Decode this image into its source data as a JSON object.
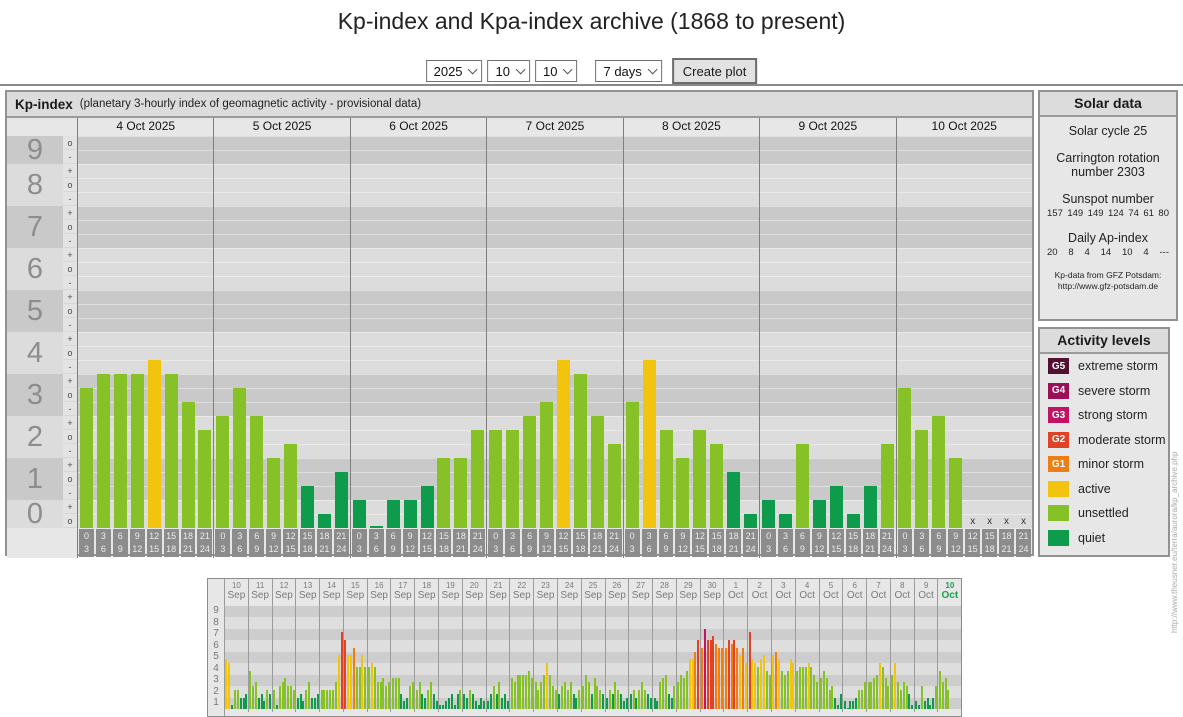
{
  "page": {
    "title": "Kp-index and Kpa-index archive (1868 to present)"
  },
  "controls": {
    "year": "2025",
    "month": "10",
    "day": "10",
    "range": "7 days",
    "create_button": "Create plot"
  },
  "colors": {
    "quiet": "#0f9b4c",
    "unsettled": "#85c127",
    "active": "#f2c40e",
    "g1": "#ef7d12",
    "g2": "#e04226",
    "g3": "#c31163",
    "g4": "#9c0e56",
    "g5": "#531031",
    "band_dark": "#c9c9c9",
    "band_light": "#dcdcdc",
    "mini_band_dark": "#cdcdcd",
    "mini_band_light": "#dedede"
  },
  "chart_data": {
    "type": "bar",
    "title": "Kp-index",
    "subtitle": "(planetary 3-hourly index of geomagnetic activity - provisional data)",
    "ylabel": "Kp",
    "ylim": [
      0,
      9
    ],
    "y_labels": [
      "9",
      "8",
      "7",
      "6",
      "5",
      "4",
      "3",
      "2",
      "1",
      "0"
    ],
    "sub_symbols": [
      "+",
      "o",
      "-"
    ],
    "intervals": [
      [
        "0",
        "3"
      ],
      [
        "3",
        "6"
      ],
      [
        "6",
        "9"
      ],
      [
        "9",
        "12"
      ],
      [
        "12",
        "15"
      ],
      [
        "15",
        "18"
      ],
      [
        "18",
        "21"
      ],
      [
        "21",
        "24"
      ]
    ],
    "no_data_marker": "x",
    "days": [
      {
        "label": "4 Oct 2025",
        "kp_thirds": [
          10,
          11,
          11,
          11,
          12,
          11,
          9,
          7
        ]
      },
      {
        "label": "5 Oct 2025",
        "kp_thirds": [
          8,
          10,
          8,
          5,
          6,
          3,
          1,
          4
        ]
      },
      {
        "label": "6 Oct 2025",
        "kp_thirds": [
          2,
          0,
          2,
          2,
          3,
          5,
          5,
          7
        ]
      },
      {
        "label": "7 Oct 2025",
        "kp_thirds": [
          7,
          7,
          8,
          9,
          12,
          11,
          8,
          6
        ]
      },
      {
        "label": "8 Oct 2025",
        "kp_thirds": [
          9,
          12,
          7,
          5,
          7,
          6,
          4,
          1
        ]
      },
      {
        "label": "9 Oct 2025",
        "kp_thirds": [
          2,
          1,
          6,
          2,
          3,
          1,
          3,
          6
        ]
      },
      {
        "label": "10 Oct 2025",
        "kp_thirds": [
          10,
          7,
          8,
          5,
          null,
          null,
          null,
          null
        ]
      }
    ]
  },
  "mini_chart": {
    "type": "bar",
    "y_labels": [
      "9",
      "8",
      "7",
      "6",
      "5",
      "4",
      "3",
      "2",
      "1"
    ],
    "days": [
      {
        "num": "10",
        "mon": "Sep",
        "t": [
          13,
          12,
          1,
          5,
          5,
          3,
          3,
          4
        ]
      },
      {
        "num": "11",
        "mon": "Sep",
        "t": [
          10,
          6,
          7,
          3,
          4,
          2,
          5,
          4
        ]
      },
      {
        "num": "12",
        "mon": "Sep",
        "t": [
          5,
          1,
          6,
          7,
          8,
          6,
          6,
          5
        ]
      },
      {
        "num": "13",
        "mon": "Sep",
        "t": [
          3,
          4,
          2,
          5,
          7,
          3,
          3,
          4
        ]
      },
      {
        "num": "14",
        "mon": "Sep",
        "t": [
          5,
          5,
          5,
          5,
          5,
          7,
          14,
          20
        ]
      },
      {
        "num": "15",
        "mon": "Sep",
        "t": [
          18,
          14,
          14,
          16,
          11,
          11,
          14,
          11
        ]
      },
      {
        "num": "16",
        "mon": "Sep",
        "t": [
          11,
          12,
          11,
          7,
          7,
          8,
          6,
          7
        ]
      },
      {
        "num": "17",
        "mon": "Sep",
        "t": [
          8,
          8,
          8,
          4,
          2,
          3,
          6,
          7
        ]
      },
      {
        "num": "18",
        "mon": "Sep",
        "t": [
          5,
          7,
          4,
          3,
          5,
          7,
          4,
          2
        ]
      },
      {
        "num": "19",
        "mon": "Sep",
        "t": [
          1,
          1,
          2,
          3,
          4,
          1,
          4,
          5
        ]
      },
      {
        "num": "20",
        "mon": "Sep",
        "t": [
          4,
          3,
          5,
          4,
          2,
          1,
          3,
          2
        ]
      },
      {
        "num": "21",
        "mon": "Sep",
        "t": [
          2,
          4,
          6,
          4,
          7,
          3,
          4,
          2
        ]
      },
      {
        "num": "22",
        "mon": "Sep",
        "t": [
          8,
          7,
          9,
          9,
          9,
          9,
          10,
          8
        ]
      },
      {
        "num": "23",
        "mon": "Sep",
        "t": [
          7,
          5,
          7,
          9,
          12,
          9,
          6,
          5
        ]
      },
      {
        "num": "24",
        "mon": "Sep",
        "t": [
          4,
          6,
          7,
          5,
          7,
          4,
          3,
          5
        ]
      },
      {
        "num": "25",
        "mon": "Sep",
        "t": [
          6,
          9,
          7,
          4,
          8,
          6,
          5,
          4
        ]
      },
      {
        "num": "26",
        "mon": "Sep",
        "t": [
          3,
          5,
          4,
          7,
          5,
          4,
          2,
          3
        ]
      },
      {
        "num": "27",
        "mon": "Sep",
        "t": [
          4,
          5,
          3,
          5,
          7,
          5,
          4,
          3
        ]
      },
      {
        "num": "28",
        "mon": "Sep",
        "t": [
          3,
          2,
          7,
          8,
          9,
          4,
          3,
          6
        ]
      },
      {
        "num": "29",
        "mon": "Sep",
        "t": [
          7,
          9,
          8,
          10,
          13,
          13,
          15,
          18
        ]
      },
      {
        "num": "30",
        "mon": "Sep",
        "t": [
          16,
          21,
          18,
          18,
          19,
          17,
          16,
          16
        ]
      },
      {
        "num": "1",
        "mon": "Oct",
        "t": [
          16,
          18,
          17,
          18,
          16,
          14,
          16,
          12
        ]
      },
      {
        "num": "2",
        "mon": "Oct",
        "t": [
          20,
          13,
          12,
          11,
          13,
          14,
          10,
          9
        ]
      },
      {
        "num": "3",
        "mon": "Oct",
        "t": [
          14,
          15,
          13,
          10,
          9,
          10,
          13,
          12
        ]
      },
      {
        "num": "4",
        "mon": "Oct",
        "t": [
          10,
          11,
          11,
          11,
          12,
          11,
          9,
          7
        ]
      },
      {
        "num": "5",
        "mon": "Oct",
        "t": [
          8,
          10,
          8,
          5,
          6,
          3,
          1,
          4
        ]
      },
      {
        "num": "6",
        "mon": "Oct",
        "t": [
          2,
          0,
          2,
          2,
          3,
          5,
          5,
          7
        ]
      },
      {
        "num": "7",
        "mon": "Oct",
        "t": [
          7,
          7,
          8,
          9,
          12,
          11,
          8,
          6
        ]
      },
      {
        "num": "8",
        "mon": "Oct",
        "t": [
          9,
          12,
          7,
          5,
          7,
          6,
          4,
          1
        ]
      },
      {
        "num": "9",
        "mon": "Oct",
        "t": [
          2,
          1,
          6,
          2,
          3,
          1,
          3,
          6
        ]
      },
      {
        "num": "10",
        "mon": "Oct",
        "t": [
          10,
          7,
          8,
          5
        ],
        "current": true
      }
    ]
  },
  "solar_data": {
    "title": "Solar data",
    "cycle_line": "Solar cycle 25",
    "carrington_line": "Carrington rotation number 2303",
    "sunspot_title": "Sunspot number",
    "sunspot_values": [
      "157",
      "149",
      "149",
      "124",
      "74",
      "61",
      "80"
    ],
    "ap_title": "Daily Ap-index",
    "ap_values": [
      "20",
      "8",
      "4",
      "14",
      "10",
      "4",
      "---"
    ],
    "source_line1": "Kp-data from GFZ Potsdam:",
    "source_line2": "http://www.gfz-potsdam.de"
  },
  "activity_levels": {
    "title": "Activity levels",
    "items": [
      {
        "code": "G5",
        "label": "extreme storm",
        "color": "#531031"
      },
      {
        "code": "G4",
        "label": "severe storm",
        "color": "#9c0e56"
      },
      {
        "code": "G3",
        "label": "strong storm",
        "color": "#c31163"
      },
      {
        "code": "G2",
        "label": "moderate storm",
        "color": "#e04226"
      },
      {
        "code": "G1",
        "label": "minor storm",
        "color": "#ef7d12"
      },
      {
        "code": "",
        "label": "active",
        "color": "#f2c40e"
      },
      {
        "code": "",
        "label": "unsettled",
        "color": "#85c127"
      },
      {
        "code": "",
        "label": "quiet",
        "color": "#0f9b4c"
      }
    ]
  },
  "watermark": {
    "text": "http://www.theusner.eu/terra/aurora/kp_archive.php"
  }
}
